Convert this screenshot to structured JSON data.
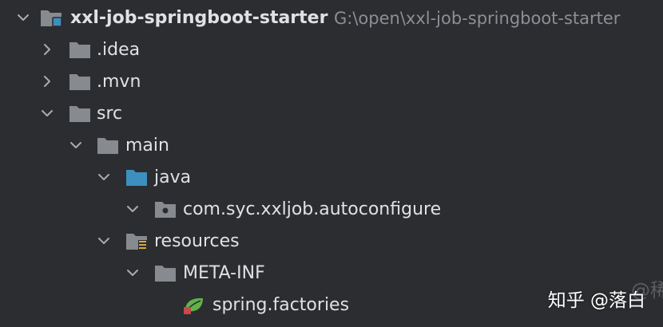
{
  "project": {
    "name": "xxl-job-springboot-starter",
    "path": "G:\\open\\xxl-job-springboot-starter"
  },
  "tree": [
    {
      "label": ".idea",
      "expanded": false,
      "icon": "folder-icon"
    },
    {
      "label": ".mvn",
      "expanded": false,
      "icon": "folder-icon"
    },
    {
      "label": "src",
      "expanded": true,
      "icon": "folder-icon"
    },
    {
      "label": "main",
      "expanded": true,
      "icon": "folder-icon"
    },
    {
      "label": "java",
      "expanded": true,
      "icon": "source-folder-icon"
    },
    {
      "label": "com.syc.xxljob.autoconfigure",
      "expanded": true,
      "icon": "package-icon"
    },
    {
      "label": "resources",
      "expanded": true,
      "icon": "resources-folder-icon"
    },
    {
      "label": "META-INF",
      "expanded": true,
      "icon": "folder-icon"
    },
    {
      "label": "spring.factories",
      "expanded": null,
      "icon": "spring-file-icon"
    }
  ],
  "watermark": {
    "text": "知乎 @落白",
    "edge_glyph": "@稀"
  },
  "colors": {
    "background": "#2b2d30",
    "text": "#dfe1e5",
    "path_text": "#8c8f94",
    "folder": "#878a8f",
    "source_folder": "#3d8fbf",
    "spring_leaf": "#5fb34a"
  }
}
